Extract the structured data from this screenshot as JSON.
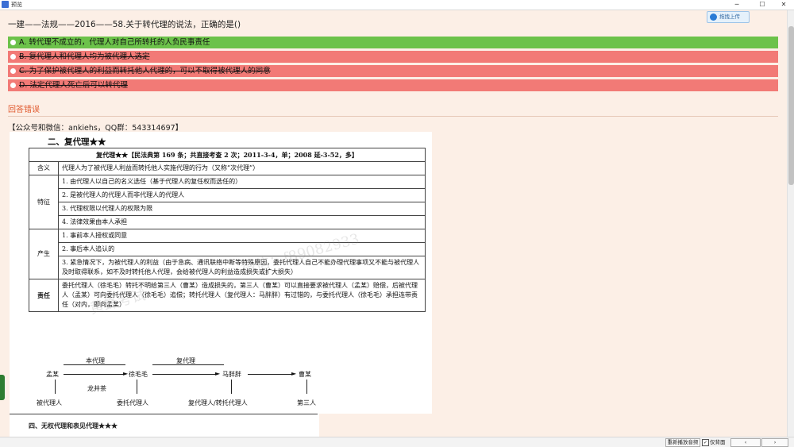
{
  "window": {
    "title": "预览",
    "controls": {
      "minimize": "─",
      "maximize": "☐",
      "close": "✕"
    }
  },
  "toolbar": {
    "upload_label": "拖拽上传"
  },
  "question": {
    "text": "一建——法规——2016——58.关于转代理的说法，正确的是()"
  },
  "options": [
    {
      "label": "A. 转代理不成立的，代理人对自己所转托的人负民事责任",
      "status": "correct"
    },
    {
      "label": "B. 复代理人和代理人均为被代理人选定",
      "status": "wrong"
    },
    {
      "label": "C. 为了保护被代理人的利益而转托他人代理的，可以不取得被代理人的同意",
      "status": "wrong"
    },
    {
      "label": "D. 法定代理人死亡后可以转代理",
      "status": "wrong"
    }
  ],
  "result": {
    "text": "回答错误"
  },
  "contact": {
    "text": "【公众号和微信：ankiehs，QQ群：543314697】"
  },
  "doc": {
    "heading": "二、复代理★★",
    "header_row": "复代理★★【民法典第 169 条；共直接考查 2 次；2011-3-4，单；2008 延-3-52，多】",
    "rows": {
      "hanyi_label": "含义",
      "hanyi_text": "代理人为了被代理人利益而转托他人实施代理的行为（又称“次代理”）",
      "tezheng_label": "特征",
      "tezheng_1": "1. 由代理人以自己的名义选任（基于代理人的复任权而选任的）",
      "tezheng_2": "2. 是被代理人的代理人而非代理人的代理人",
      "tezheng_3": "3. 代理权限以代理人的权限为限",
      "tezheng_4": "4. 法律效果由本人承担",
      "chansheng_label": "产生",
      "chansheng_1": "1. 事前本人授权或同意",
      "chansheng_2": "2. 事后本人追认的",
      "chansheng_3": "3. 紧急情况下，为被代理人的利益（由于急病、通讯联络中断等特殊原因，委托代理人自己不能办理代理事项又不能与被代理人及时取得联系，如不及时转托他人代理，会给被代理人的利益造成损失或扩大损失）",
      "zeren_label": "责任",
      "zeren_text": "委托代理人（徐毛毛）转托不明给第三人（曹某）造成损失的，第三人（曹某）可以直接要求被代理人（孟某）赔偿，后被代理人（孟某）可向委托代理人（徐毛毛）追偿；转托代理人（复代理人：马胖胖）有过错的，与委托代理人（徐毛毛）承担连带责任（对内，即向孟某）"
    },
    "watermark": {
      "a": "微信：f89082933",
      "b": "黄蜂考试"
    },
    "diagram": {
      "top_label_1": "本代理",
      "top_label_2": "复代理",
      "node_1": "孟某",
      "node_2": "徐毛毛",
      "node_3": "马胖胖",
      "node_4": "曹某",
      "mid_label": "龙井茶",
      "bottom_1": "被代理人",
      "bottom_2": "委托代理人",
      "bottom_3": "复代理人/转托代理人",
      "bottom_4": "第三人"
    },
    "next_section": "四、无权代理和表见代理★★★"
  },
  "bottombar": {
    "btn_reset": "重新播放音频",
    "chk_label": "仅背面",
    "btn_prev": "‹",
    "btn_next": "›"
  }
}
